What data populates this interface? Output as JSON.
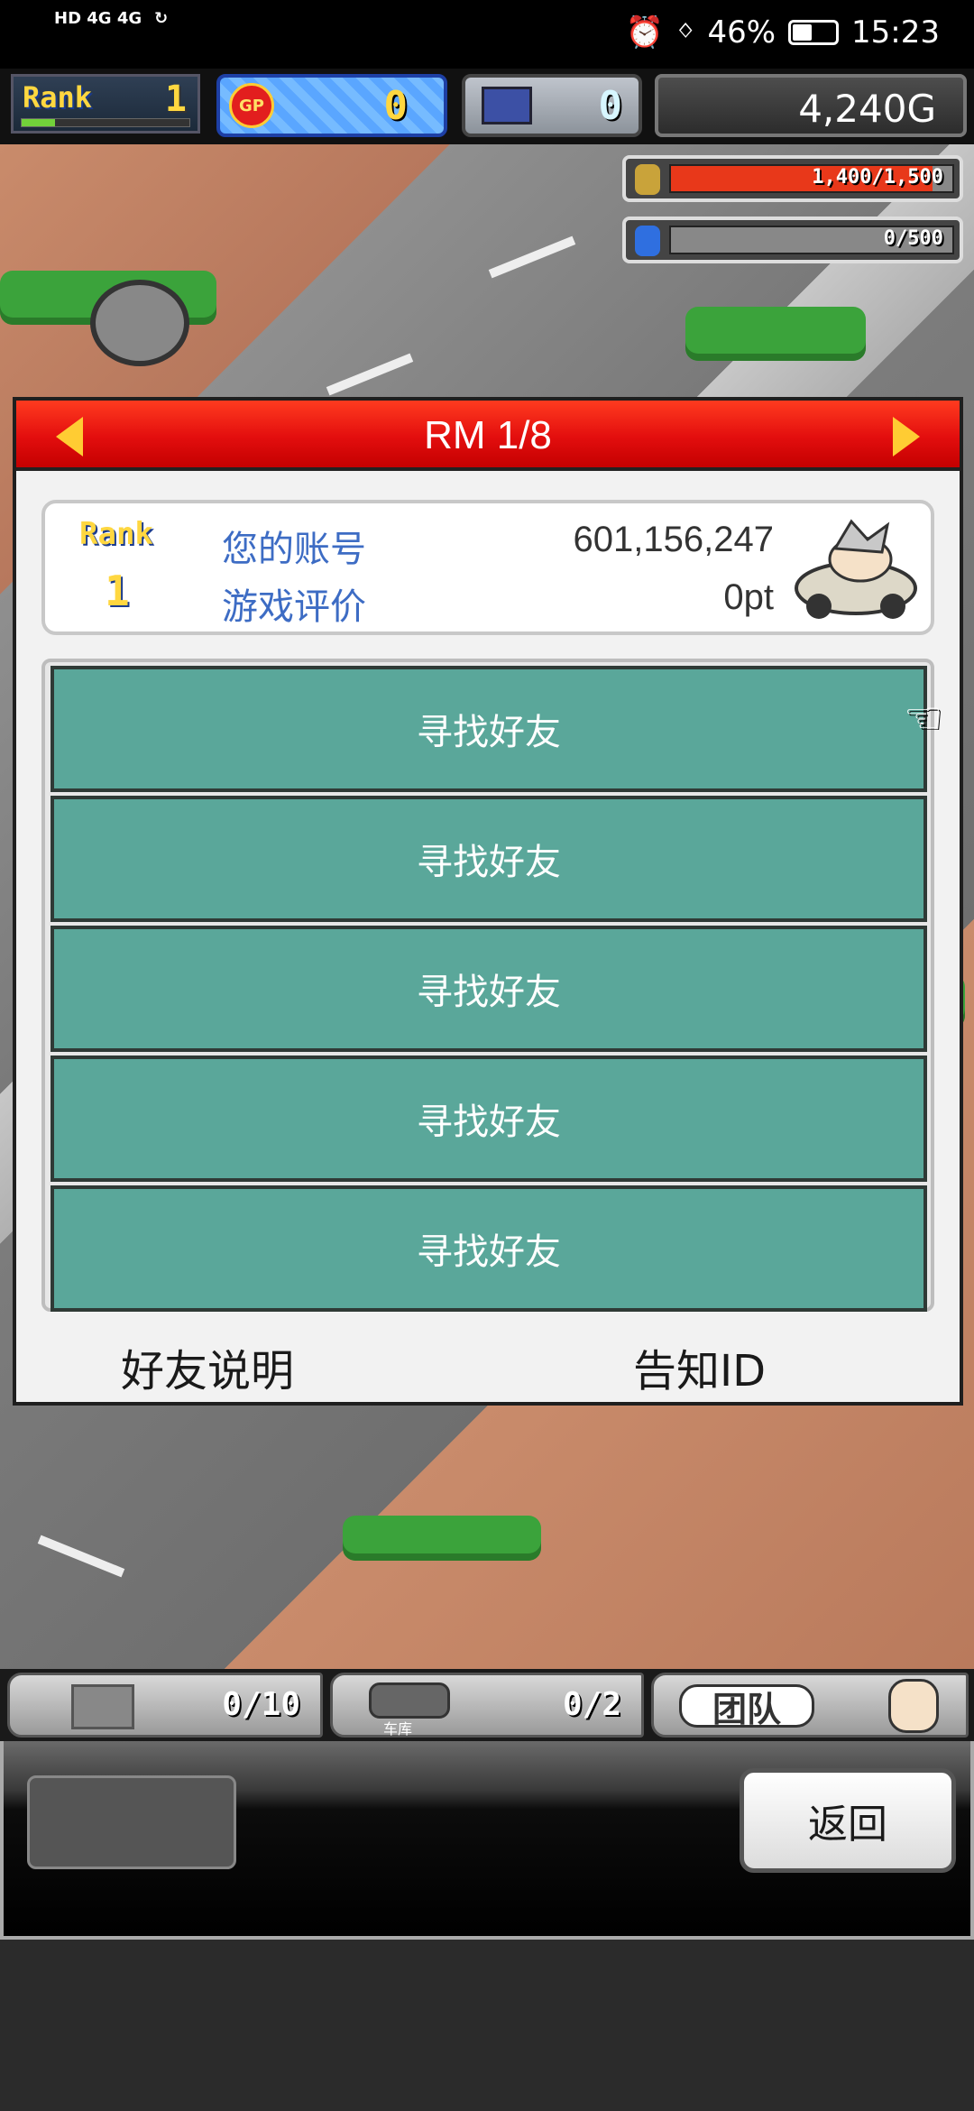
{
  "status_bar": {
    "network_left": "HD 4G 4G",
    "battery": "46%",
    "time": "15:23",
    "battery_level": 0.46
  },
  "hud": {
    "rank_label": "Rank",
    "rank_value": "1",
    "rank_progress": 0.2,
    "gp_icon_text": "GP",
    "gp_value": "0",
    "research_value": "0",
    "gold": "4,240G"
  },
  "resources": {
    "fuel_text": "1,400/1,500",
    "fuel_fill": 0.93,
    "fuel_color": "#e8381a",
    "blue_text": "0/500",
    "blue_fill": 0.0
  },
  "dialog": {
    "title": "RM 1/8",
    "info": {
      "rank_label": "Rank",
      "rank_value": "1",
      "account_label": "您的账号",
      "account_value": "601,156,247",
      "rating_label": "游戏评价",
      "rating_value": "0pt"
    },
    "friend_slots": [
      {
        "label": "寻找好友"
      },
      {
        "label": "寻找好友"
      },
      {
        "label": "寻找好友"
      },
      {
        "label": "寻找好友"
      },
      {
        "label": "寻找好友"
      }
    ],
    "footer": {
      "explain_label": "好友说明",
      "notify_label": "告知ID"
    }
  },
  "bottom_bar": {
    "crate_value": "0/10",
    "garage_label": "车库",
    "garage_value": "0/2",
    "team_label": "团队"
  },
  "panel": {
    "back_label": "返回"
  },
  "colors": {
    "header_red": "#e30e0e",
    "friend_teal": "#5aa79a",
    "label_blue": "#3d6cc4",
    "rank_gold": "#ffd740"
  }
}
